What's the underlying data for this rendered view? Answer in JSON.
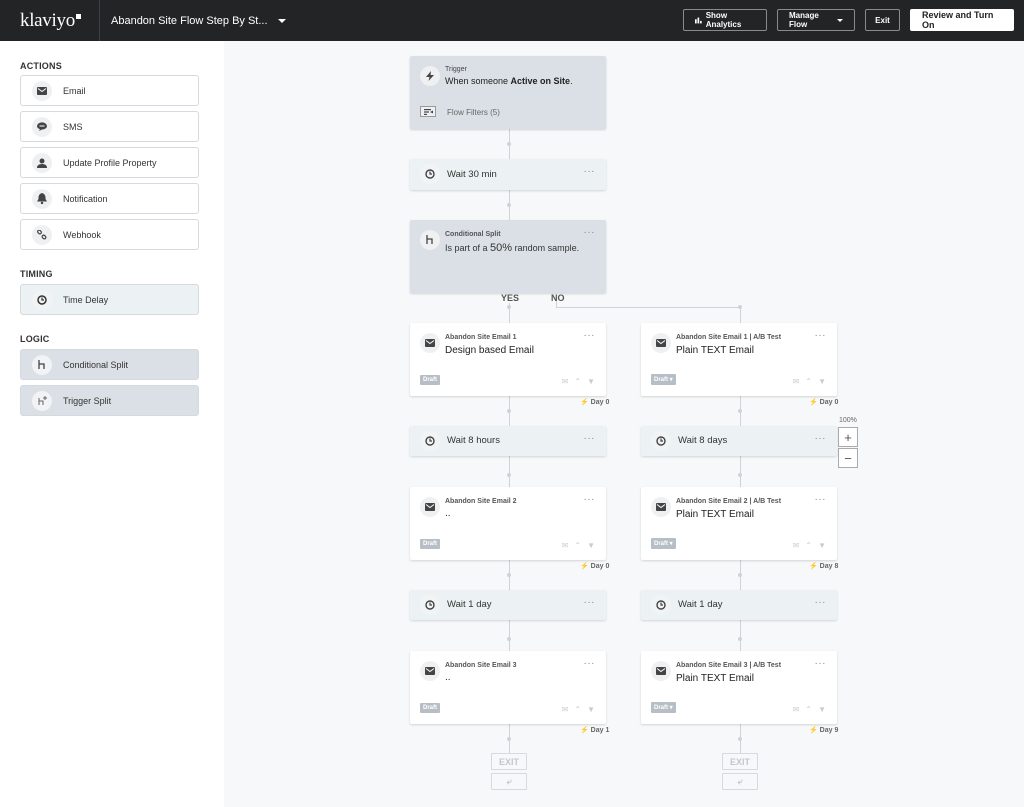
{
  "topbar": {
    "logo": "klaviyo",
    "flow_title": "Abandon Site Flow Step By St...",
    "buttons": {
      "show_analytics": "Show Analytics",
      "manage_flow": "Manage Flow",
      "exit": "Exit",
      "review": "Review and Turn On"
    }
  },
  "sidebar": {
    "sections": {
      "actions": "ACTIONS",
      "timing": "TIMING",
      "logic": "LOGIC"
    },
    "actions": [
      {
        "label": "Email",
        "icon": "envelope-icon"
      },
      {
        "label": "SMS",
        "icon": "chat-bubble-icon"
      },
      {
        "label": "Update Profile Property",
        "icon": "person-icon"
      },
      {
        "label": "Notification",
        "icon": "bell-icon"
      },
      {
        "label": "Webhook",
        "icon": "link-icon"
      }
    ],
    "timing": [
      {
        "label": "Time Delay",
        "icon": "clock-icon"
      }
    ],
    "logic": [
      {
        "label": "Conditional Split",
        "icon": "split-icon"
      },
      {
        "label": "Trigger Split",
        "icon": "trigger-split-icon"
      }
    ]
  },
  "flow": {
    "trigger": {
      "title": "Trigger",
      "text_prefix": "When someone ",
      "text_bold": "Active on Site",
      "text_suffix": ".",
      "filters": "Flow Filters (5)"
    },
    "wait1": "Wait 30 min",
    "split": {
      "title": "Conditional Split",
      "text_prefix": "Is part of a ",
      "text_bold": "50%",
      "text_suffix": " random sample.",
      "yes": "YES",
      "no": "NO"
    },
    "left": {
      "email1": {
        "title": "Abandon Site Email 1",
        "subject": "Design based Email",
        "status": "Draft",
        "day": "Day 0"
      },
      "wait2": "Wait 8 hours",
      "email2": {
        "title": "Abandon Site Email 2",
        "subject": "..",
        "status": "Draft",
        "day": "Day 0"
      },
      "wait3": "Wait 1 day",
      "email3": {
        "title": "Abandon Site Email 3",
        "subject": "..",
        "status": "Draft",
        "day": "Day 1"
      },
      "exit": "EXIT"
    },
    "right": {
      "email1": {
        "title": "Abandon Site Email 1 | A/B Test",
        "subject": "Plain TEXT Email",
        "status": "Draft",
        "day": "Day 0"
      },
      "wait2": "Wait 8 days",
      "email2": {
        "title": "Abandon Site Email 2 | A/B Test",
        "subject": "Plain TEXT Email",
        "status": "Draft",
        "day": "Day 8"
      },
      "wait3": "Wait 1 day",
      "email3": {
        "title": "Abandon Site Email 3 | A/B Test",
        "subject": "Plain TEXT Email",
        "status": "Draft",
        "day": "Day 9"
      },
      "exit": "EXIT"
    },
    "zoom": {
      "level": "100%",
      "plus": "+",
      "minus": "−"
    }
  }
}
